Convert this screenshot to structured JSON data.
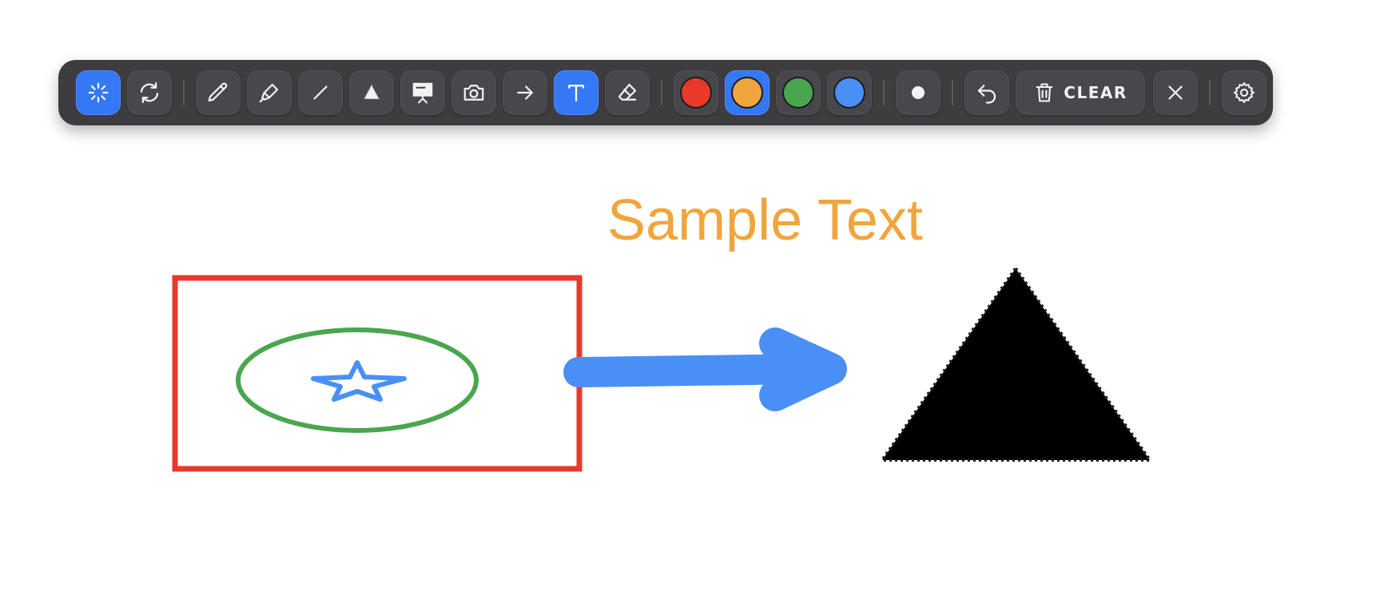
{
  "toolbar": {
    "tools": [
      {
        "id": "laser",
        "icon": "sparkle-icon",
        "active": true
      },
      {
        "id": "refresh",
        "icon": "refresh-icon",
        "active": false
      },
      {
        "id": "pen",
        "icon": "pencil-icon",
        "active": false
      },
      {
        "id": "highlighter",
        "icon": "highlighter-icon",
        "active": false
      },
      {
        "id": "line",
        "icon": "line-icon",
        "active": false
      },
      {
        "id": "shape",
        "icon": "triangle-icon",
        "active": false
      },
      {
        "id": "whiteboard",
        "icon": "whiteboard-icon",
        "active": false
      },
      {
        "id": "screenshot",
        "icon": "camera-icon",
        "active": false
      },
      {
        "id": "arrow",
        "icon": "arrow-right-icon",
        "active": false
      },
      {
        "id": "text",
        "icon": "text-icon",
        "active": true
      },
      {
        "id": "eraser",
        "icon": "eraser-icon",
        "active": false
      }
    ],
    "colors": [
      {
        "name": "red",
        "hex": "#e8392b",
        "active": false
      },
      {
        "name": "orange",
        "hex": "#f0a53c",
        "active": true
      },
      {
        "name": "green",
        "hex": "#4aa64e",
        "active": false
      },
      {
        "name": "blue",
        "hex": "#4a8ff5",
        "active": false
      }
    ],
    "clear_label": "CLEAR",
    "accent": "#3478f6"
  },
  "canvas": {
    "text_annotation": "Sample Text",
    "colors": {
      "rectangle": "#e8392b",
      "ellipse": "#4aa64e",
      "star": "#4a8ff5",
      "arrow": "#4a8ff5",
      "triangle": "#000000",
      "text": "#f0a53c"
    }
  }
}
